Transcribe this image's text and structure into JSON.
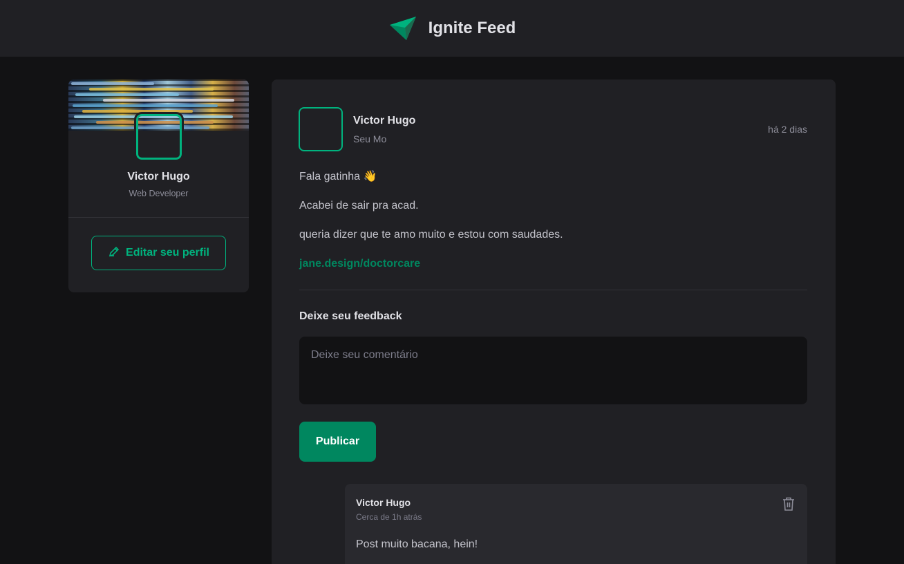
{
  "header": {
    "title": "Ignite Feed",
    "logo_icon": "ignite-logo-icon"
  },
  "sidebar": {
    "name": "Victor Hugo",
    "role": "Web Developer",
    "edit_button": "Editar seu perfil"
  },
  "post": {
    "author_name": "Victor Hugo",
    "author_role": "Seu Mo",
    "time": "há 2 dias",
    "content": {
      "line1": "Fala gatinha 👋",
      "line2": "Acabei de sair pra acad.",
      "line3": "queria dizer que te amo muito e estou com saudades.",
      "link": "jane.design/doctorcare"
    },
    "feedback_title": "Deixe seu feedback",
    "comment_placeholder": "Deixe seu comentário",
    "publish_button": "Publicar"
  },
  "comment": {
    "author": "Victor Hugo",
    "time": "Cerca de 1h atrás",
    "text": "Post muito bacana, hein!",
    "delete_icon": "trash-icon"
  },
  "colors": {
    "accent": "#00b37e",
    "accent_dark": "#00875f",
    "background": "#121214",
    "surface": "#202024"
  }
}
